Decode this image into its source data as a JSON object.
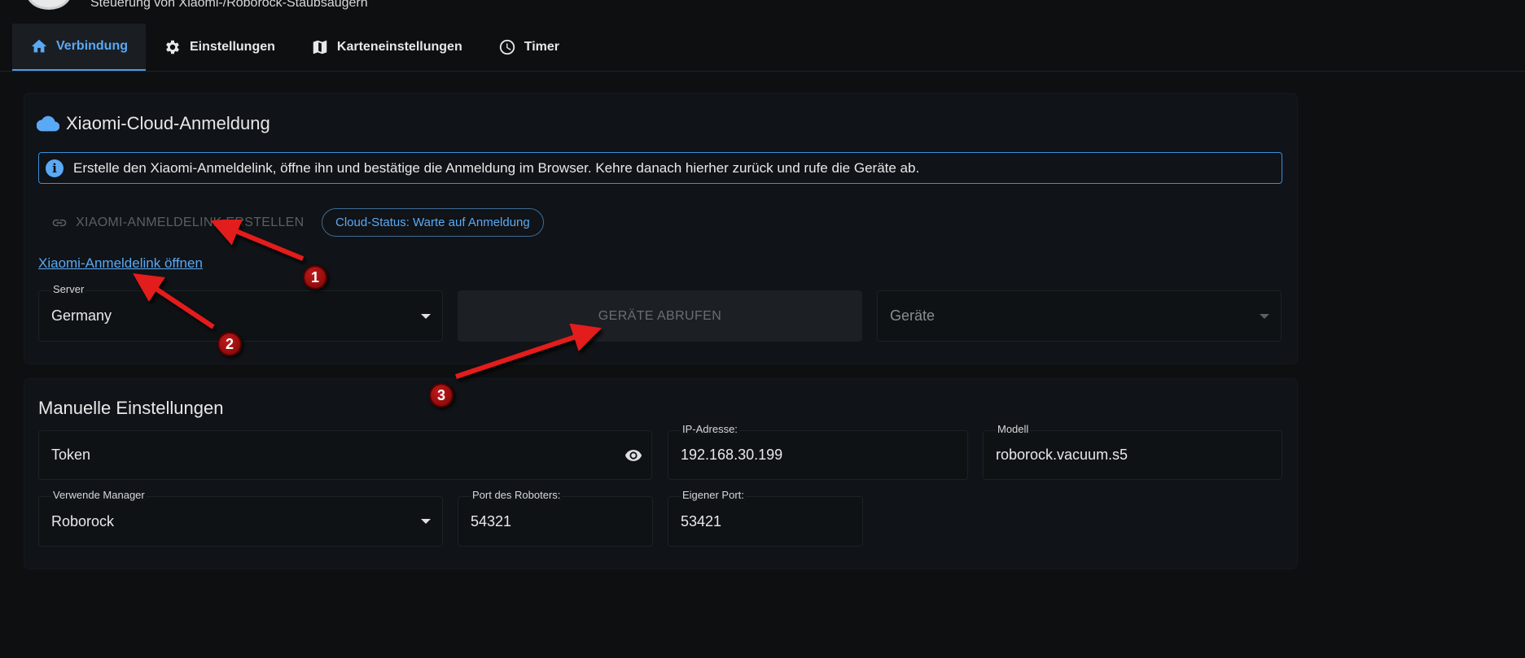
{
  "header": {
    "subtitle": "Steuerung von Xiaomi-/Roborock-Staubsaugern"
  },
  "tabs": [
    {
      "label": "Verbindung",
      "icon": "home-icon",
      "active": true
    },
    {
      "label": "Einstellungen",
      "icon": "gear-icon",
      "active": false
    },
    {
      "label": "Karteneinstellungen",
      "icon": "map-icon",
      "active": false
    },
    {
      "label": "Timer",
      "icon": "clock-icon",
      "active": false
    }
  ],
  "cloud": {
    "title": "Xiaomi-Cloud-Anmeldung",
    "info": "Erstelle den Xiaomi-Anmeldelink, öffne ihn und bestätige die Anmeldung im Browser. Kehre danach hierher zurück und rufe die Geräte ab.",
    "create_link_button": "XIAOMI-ANMELDELINK ERSTELLEN",
    "status_chip": "Cloud-Status: Warte auf Anmeldung",
    "open_link": "Xiaomi-Anmeldelink öffnen",
    "server": {
      "label": "Server",
      "value": "Germany"
    },
    "fetch_button": "GERÄTE ABRUFEN",
    "devices": {
      "placeholder": "Geräte"
    }
  },
  "manual": {
    "title": "Manuelle Einstellungen",
    "token": {
      "label": "Token"
    },
    "ip": {
      "label": "IP-Adresse:",
      "value": "192.168.30.199"
    },
    "model": {
      "label": "Modell",
      "value": "roborock.vacuum.s5"
    },
    "manager": {
      "label": "Verwende Manager",
      "value": "Roborock"
    },
    "robot_port": {
      "label": "Port des Roboters:",
      "value": "54321"
    },
    "own_port": {
      "label": "Eigener Port:",
      "value": "53421"
    }
  },
  "annotations": [
    "1",
    "2",
    "3"
  ],
  "colors": {
    "accent": "#5aa9f4",
    "background": "#0d0f11",
    "arrow": "#e31b1b"
  }
}
